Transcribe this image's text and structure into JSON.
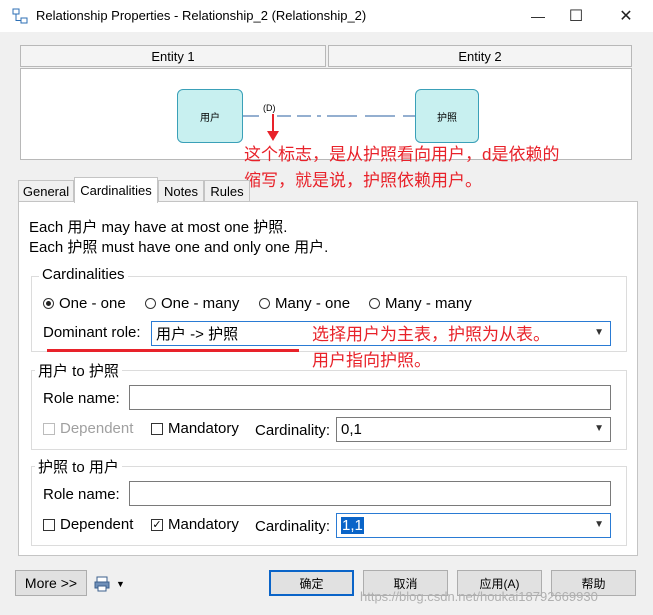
{
  "window": {
    "title": "Relationship Properties - Relationship_2 (Relationship_2)",
    "minimize": "—",
    "maximize": "☐",
    "close": "✕"
  },
  "header": {
    "entity1": "Entity 1",
    "entity2": "Entity 2"
  },
  "diagram": {
    "entity1_name": "用户",
    "entity2_name": "护照",
    "dependency_mark": "(D)"
  },
  "annotations": {
    "note1_line1": "这个标志，是从护照看向用户，d是依赖的",
    "note1_line2": "缩写，就是说，护照依赖用户。",
    "note2_line1": "选择用户为主表，护照为从表。",
    "note2_line2": "用户指向护照。",
    "accent_color": "#e8222a"
  },
  "tabs": [
    {
      "label": "General"
    },
    {
      "label": "Cardinalities"
    },
    {
      "label": "Notes"
    },
    {
      "label": "Rules"
    }
  ],
  "panel": {
    "sentence1": "Each 用户 may have at most one 护照.",
    "sentence2": "Each 护照 must have one and only one 用户.",
    "cardinalities_title": "Cardinalities",
    "radios": [
      {
        "label": "One - one",
        "checked": true
      },
      {
        "label": "One - many",
        "checked": false
      },
      {
        "label": "Many - one",
        "checked": false
      },
      {
        "label": "Many - many",
        "checked": false
      }
    ],
    "dominant_role_label": "Dominant role:",
    "dominant_role_value": "用户 -> 护照",
    "role1": {
      "title": "用户 to 护照",
      "role_name_label": "Role name:",
      "role_name_value": "",
      "dependent_label": "Dependent",
      "mandatory_label": "Mandatory",
      "cardinality_label": "Cardinality:",
      "cardinality_value": "0,1"
    },
    "role2": {
      "title": "护照 to 用户",
      "role_name_label": "Role name:",
      "role_name_value": "",
      "dependent_label": "Dependent",
      "mandatory_label": "Mandatory",
      "mandatory_mark": "✓",
      "cardinality_label": "Cardinality:",
      "cardinality_value": "1,1"
    }
  },
  "footer": {
    "more": "More >>",
    "ok": "确定",
    "cancel": "取消",
    "apply": "应用(A)",
    "help": "帮助"
  },
  "watermark": "https://blog.csdn.net/houkai18792669930",
  "icons": {
    "app": "relationship-icon",
    "dropdown": "chevron-down-icon",
    "print": "print-icon"
  }
}
